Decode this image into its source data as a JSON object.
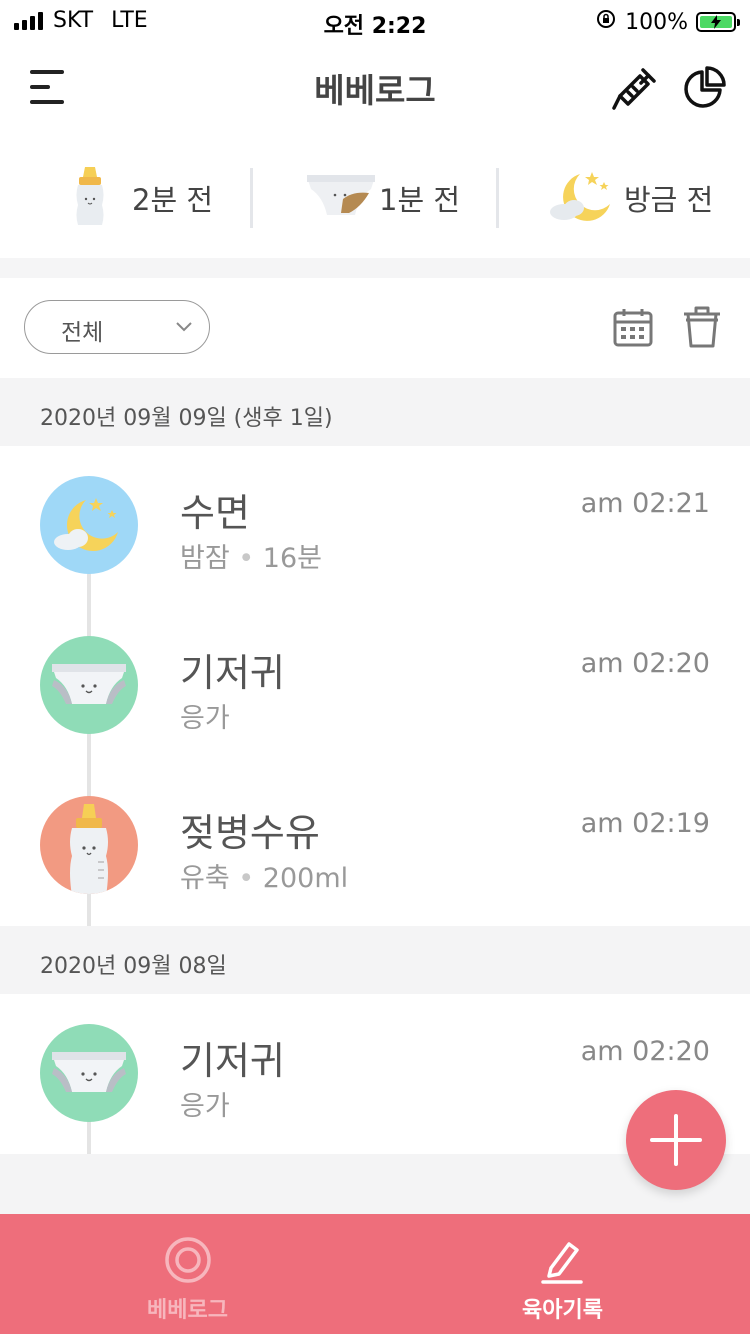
{
  "status_bar": {
    "carrier": "SKT",
    "network": "LTE",
    "time": "오전 2:22",
    "battery": "100%"
  },
  "header": {
    "title": "베베로그",
    "menu_icon": "hamburger-menu-icon",
    "vaccine_icon": "syringe-icon",
    "stats_icon": "pie-chart-icon"
  },
  "summary": [
    {
      "icon": "baby-bottle-icon",
      "label": "2분 전"
    },
    {
      "icon": "diaper-icon",
      "label": "1분 전"
    },
    {
      "icon": "moon-sleep-icon",
      "label": "방금 전"
    }
  ],
  "filter": {
    "selected": "전체",
    "calendar_icon": "calendar-icon",
    "delete_icon": "trash-icon"
  },
  "days": [
    {
      "date": "2020년 09월 09일 (생후 1일)",
      "entries": [
        {
          "type": "sleep",
          "title": "수면",
          "detail": "밤잠",
          "amount": "16분",
          "time": "am 02:21",
          "color": "#9fd8f7"
        },
        {
          "type": "diaper",
          "title": "기저귀",
          "detail": "응가",
          "amount": "",
          "time": "am 02:20",
          "color": "#8fdcb7"
        },
        {
          "type": "bottle",
          "title": "젖병수유",
          "detail": "유축",
          "amount": "200ml",
          "time": "am 02:19",
          "color": "#f29a82"
        }
      ]
    },
    {
      "date": "2020년 09월 08일",
      "entries": [
        {
          "type": "diaper",
          "title": "기저귀",
          "detail": "응가",
          "amount": "",
          "time": "am 02:20",
          "color": "#8fdcb7"
        }
      ]
    }
  ],
  "fab": {
    "icon": "plus-icon"
  },
  "bottom_nav": {
    "tabs": [
      {
        "label": "베베로그",
        "icon": "target-icon",
        "active": false
      },
      {
        "label": "육아기록",
        "icon": "pencil-icon",
        "active": true
      }
    ]
  },
  "colors": {
    "accent": "#ee6e7b",
    "sleep": "#9fd8f7",
    "diaper": "#8fdcb7",
    "bottle": "#f29a82"
  }
}
